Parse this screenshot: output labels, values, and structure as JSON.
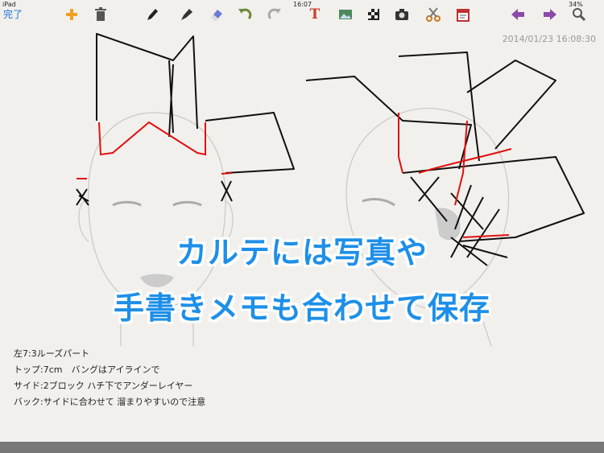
{
  "status_bar": {
    "device": "iPad",
    "time": "16:07",
    "battery": "34%"
  },
  "toolbar": {
    "done_label": "完了",
    "tools": [
      {
        "name": "add-icon"
      },
      {
        "name": "trash-icon"
      },
      {
        "name": "pencil-icon"
      },
      {
        "name": "marker-icon"
      },
      {
        "name": "eraser-icon"
      },
      {
        "name": "undo-icon"
      },
      {
        "name": "redo-icon"
      },
      {
        "name": "text-icon",
        "glyph": "T"
      },
      {
        "name": "image-icon"
      },
      {
        "name": "pattern-icon"
      },
      {
        "name": "camera-icon"
      },
      {
        "name": "scissors-icon"
      },
      {
        "name": "calendar-icon"
      },
      {
        "name": "arrow-left-icon"
      },
      {
        "name": "arrow-right-icon"
      },
      {
        "name": "magnifier-icon"
      }
    ]
  },
  "timestamp": "2014/01/23 16:08:30",
  "overlay": {
    "line1": "カルテには写真や",
    "line2": "手書きメモも合わせて保存"
  },
  "notes": [
    "左7:3ルーズパート",
    "トップ:7cm　バングはアイラインで",
    "サイド:2ブロック ハチ下でアンダーレイヤー",
    "バック:サイドに合わせて 溜まりやすいので注意"
  ],
  "colors": {
    "accent": "#1e8fe8",
    "sketch_black": "#111111",
    "sketch_red": "#e01010",
    "guide_gray": "#c8c8c8"
  }
}
